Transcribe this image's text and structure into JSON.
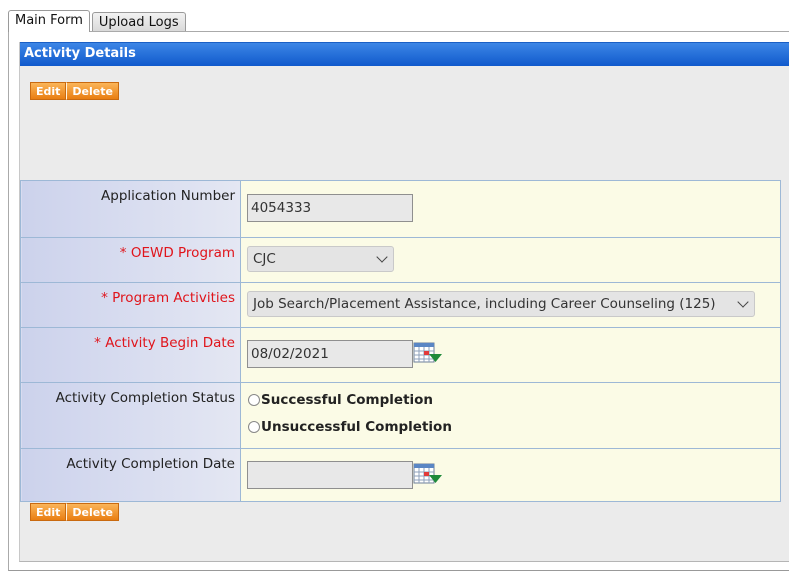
{
  "tabs": [
    {
      "label": "Main Form"
    },
    {
      "label": "Upload Logs"
    }
  ],
  "section": {
    "title": "Activity Details"
  },
  "buttons": {
    "edit": "Edit",
    "delete": "Delete"
  },
  "fields": {
    "application_number": {
      "label": "Application Number",
      "value": "4054333"
    },
    "oewd_program": {
      "label": "* OEWD Program",
      "value": "CJC"
    },
    "program_activities": {
      "label": "* Program Activities",
      "value": "Job Search/Placement Assistance, including Career Counseling (125)"
    },
    "activity_begin_date": {
      "label": "* Activity Begin Date",
      "value": "08/02/2021"
    },
    "activity_completion_status": {
      "label": "Activity Completion Status",
      "options": [
        "Successful Completion",
        "Unsuccessful Completion"
      ]
    },
    "activity_completion_date": {
      "label": "Activity Completion Date",
      "value": ""
    }
  },
  "colors": {
    "header_blue": "#1f6fd8",
    "button_orange": "#f08d22",
    "required_red": "#e0141b",
    "value_bg": "#fbfbe6"
  },
  "icons": [
    "calendar-icon",
    "chevron-down-icon"
  ]
}
